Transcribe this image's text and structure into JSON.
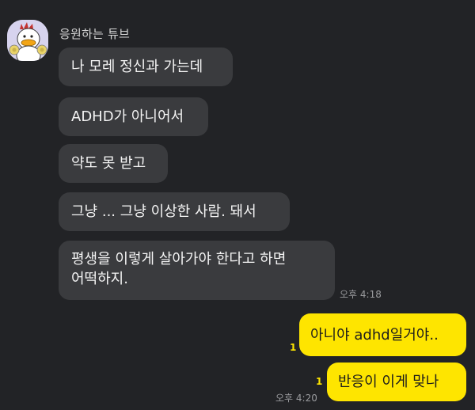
{
  "sender": {
    "name": "응원하는 튜브"
  },
  "incoming_messages": [
    {
      "text": "나 모레 정신과 가는데"
    },
    {
      "text": "ADHD가 아니어서"
    },
    {
      "text": "약도 못 받고"
    },
    {
      "text": "그냥 ... 그냥 이상한 사람. 돼서"
    },
    {
      "lines": [
        "평생을 이렇게 살아가야 한다고 하면",
        "어떡하지."
      ],
      "time": "오후 4:18"
    }
  ],
  "outgoing_messages": [
    {
      "text": "아니야 adhd일거야..",
      "unread": "1"
    },
    {
      "text": "반응이 이게 맞나",
      "unread": "1",
      "time": "오후 4:20"
    }
  ],
  "colors": {
    "background": "#222326",
    "incoming_bubble": "#3a3b3e",
    "outgoing_bubble": "#fee500",
    "unread_count": "#fee500"
  }
}
